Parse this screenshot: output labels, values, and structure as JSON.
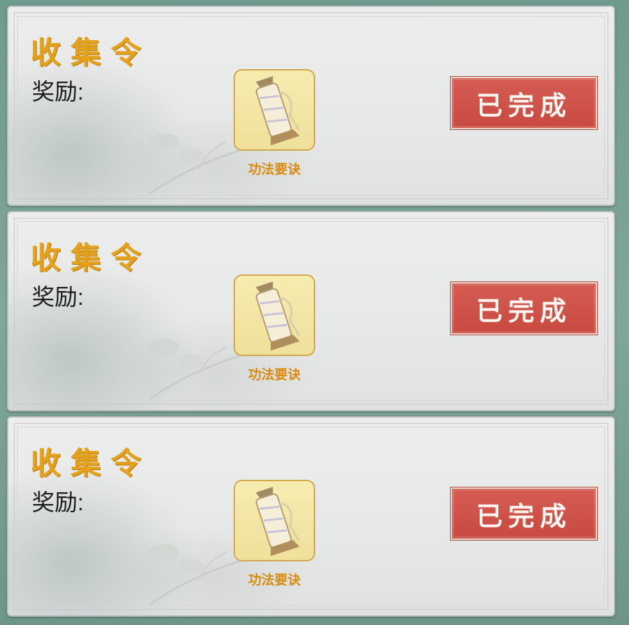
{
  "tasks": [
    {
      "title": "收集令",
      "reward_label": "奖励:",
      "reward_item": {
        "name": "功法要诀",
        "icon": "scroll-icon"
      },
      "status_label": "已完成"
    },
    {
      "title": "收集令",
      "reward_label": "奖励:",
      "reward_item": {
        "name": "功法要诀",
        "icon": "scroll-icon"
      },
      "status_label": "已完成"
    },
    {
      "title": "收集令",
      "reward_label": "奖励:",
      "reward_item": {
        "name": "功法要诀",
        "icon": "scroll-icon"
      },
      "status_label": "已完成"
    }
  ],
  "colors": {
    "title": "#e4a11c",
    "button": "#c84a41",
    "item_frame": "#f3e6a6",
    "background": "#7fa79a"
  }
}
